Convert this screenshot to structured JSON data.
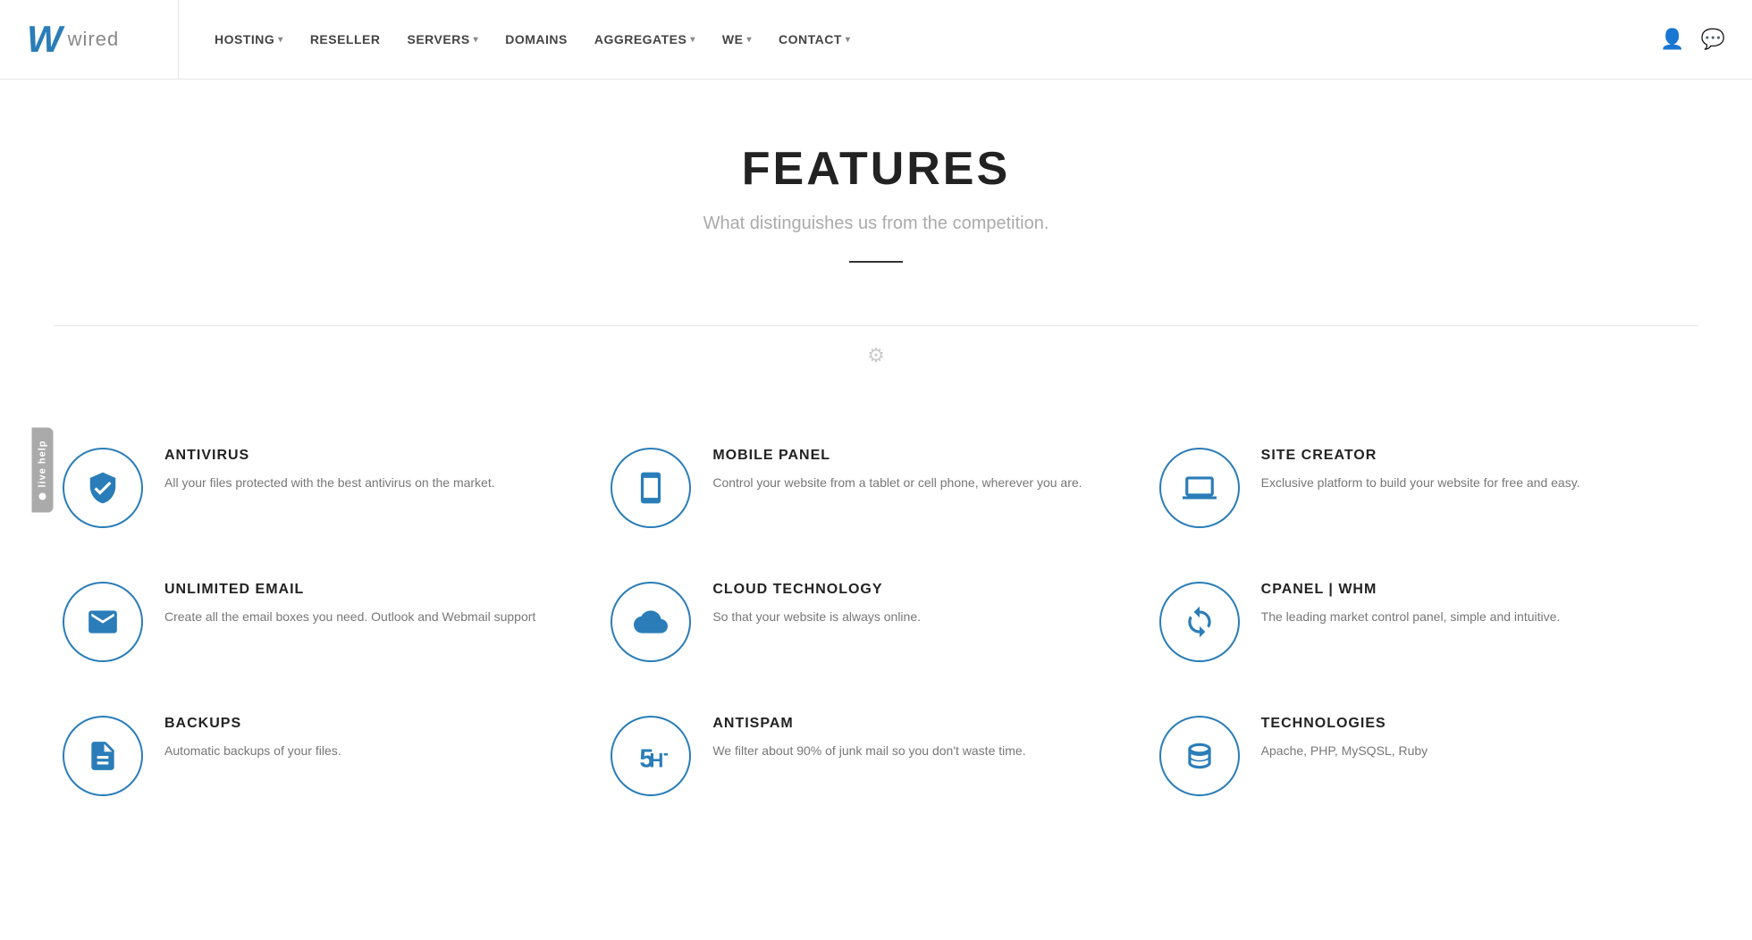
{
  "brand": {
    "logo_letter": "W",
    "logo_name": "wired"
  },
  "nav": {
    "items": [
      {
        "label": "HOSTING",
        "has_dropdown": true
      },
      {
        "label": "RESELLER",
        "has_dropdown": false
      },
      {
        "label": "SERVERS",
        "has_dropdown": true
      },
      {
        "label": "DOMAINS",
        "has_dropdown": false
      },
      {
        "label": "AGGREGATES",
        "has_dropdown": true
      },
      {
        "label": "WE",
        "has_dropdown": true
      },
      {
        "label": "CONTACT",
        "has_dropdown": true
      }
    ]
  },
  "live_help": {
    "label": "live help"
  },
  "hero": {
    "title": "FEATURES",
    "subtitle": "What distinguishes us from the competition."
  },
  "features": [
    {
      "icon": "shield",
      "title": "ANTIVIRUS",
      "desc": "All your files protected with the best antivirus on the market."
    },
    {
      "icon": "mobile",
      "title": "MOBILE PANEL",
      "desc": "Control your website from a tablet or cell phone, wherever you are."
    },
    {
      "icon": "laptop",
      "title": "SITE CREATOR",
      "desc": "Exclusive platform to build your website for free and easy."
    },
    {
      "icon": "email",
      "title": "UNLIMITED EMAIL",
      "desc": "Create all the email boxes you need. Outlook and Webmail support"
    },
    {
      "icon": "cloud",
      "title": "CLOUD TECHNOLOGY",
      "desc": "So that your website is always online."
    },
    {
      "icon": "cpanel",
      "title": "CPANEL | WHM",
      "desc": "The leading market control panel, simple and intuitive."
    },
    {
      "icon": "backup",
      "title": "BACKUPS",
      "desc": "Automatic backups of your files."
    },
    {
      "icon": "antispam",
      "title": "ANTISPAM",
      "desc": "We filter about 90% of junk mail so you don't waste time."
    },
    {
      "icon": "db",
      "title": "TECHNOLOGIES",
      "desc": "Apache, PHP, MySQSL, Ruby"
    }
  ],
  "colors": {
    "blue": "#2a7db8",
    "text_dark": "#222",
    "text_light": "#aaa",
    "border": "#e5e5e5"
  }
}
